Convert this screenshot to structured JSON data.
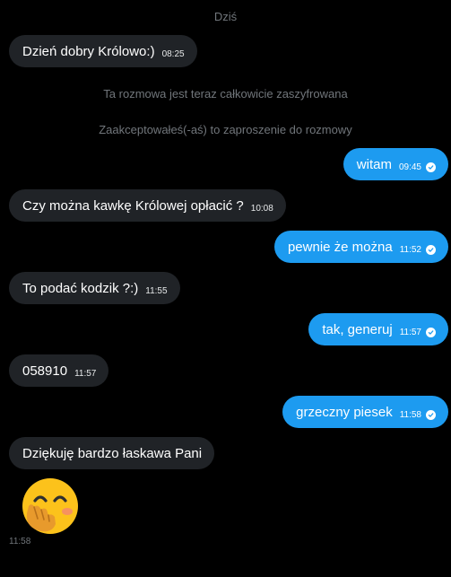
{
  "day_label": "Dziś",
  "system": {
    "encrypted": "Ta rozmowa jest teraz całkowicie zaszyfrowana",
    "accepted": "Zaakceptowałeś(-aś) to zaproszenie do rozmowy"
  },
  "colors": {
    "background": "#000000",
    "incoming_bubble": "#202327",
    "outgoing_bubble": "#1d9bf0",
    "muted_text": "#71767b"
  },
  "messages": [
    {
      "direction": "in",
      "text": "Dzień dobry Królowo:)",
      "time": "08:25"
    },
    {
      "direction": "out",
      "text": "witam",
      "time": "09:45",
      "status_icon": "read-check-icon"
    },
    {
      "direction": "in",
      "text": "Czy można kawkę Królowej opłacić ?",
      "time": "10:08"
    },
    {
      "direction": "out",
      "text": "pewnie że można",
      "time": "11:52",
      "status_icon": "read-check-icon"
    },
    {
      "direction": "in",
      "text": "To podać kodzik ?:)",
      "time": "11:55"
    },
    {
      "direction": "out",
      "text": "tak, generuj",
      "time": "11:57",
      "status_icon": "read-check-icon"
    },
    {
      "direction": "in",
      "text": "058910",
      "time": "11:57"
    },
    {
      "direction": "out",
      "text": "grzeczny piesek",
      "time": "11:58",
      "status_icon": "read-check-icon"
    },
    {
      "direction": "in",
      "text": "Dziękuję bardzo łaskawa Pani",
      "time": null
    },
    {
      "direction": "in",
      "emoji": "face-with-hand-over-mouth",
      "time": "11:58"
    }
  ]
}
